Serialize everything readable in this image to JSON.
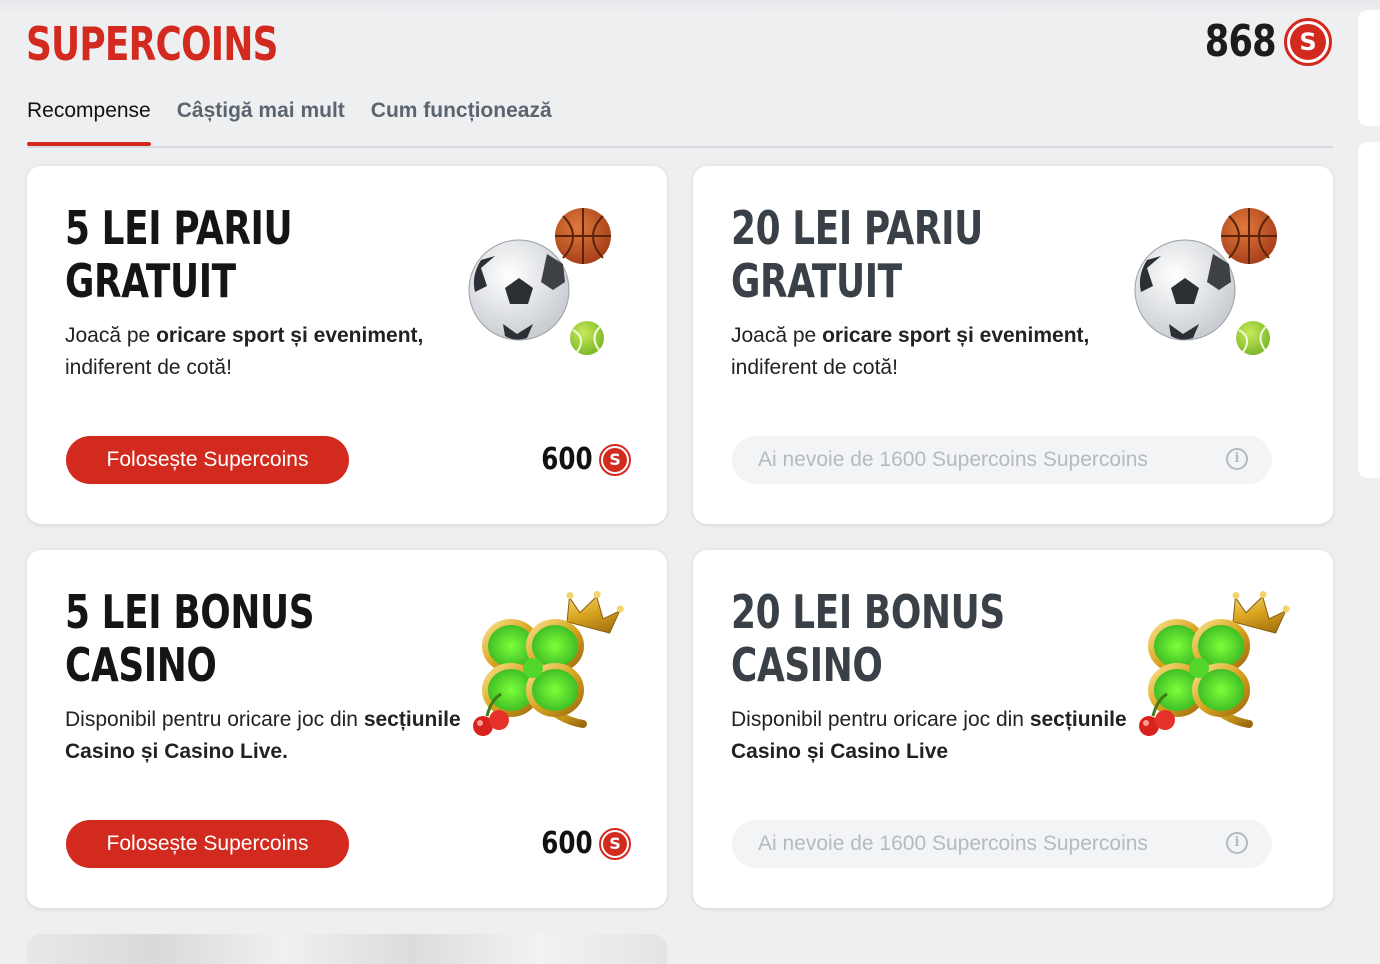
{
  "header": {
    "title": "SUPERCOINS",
    "balance": "868",
    "coin_symbol": "S"
  },
  "tabs": [
    {
      "label": "Recompense",
      "active": true
    },
    {
      "label": "Câștigă mai mult",
      "active": false
    },
    {
      "label": "Cum funcționează",
      "active": false
    }
  ],
  "cards": [
    {
      "title_line1": "5 LEI PARIU",
      "title_line2": "GRATUIT",
      "desc_pre": "Joacă pe ",
      "desc_bold": "oricare sport și eveniment,",
      "desc_post": " indiferent de cotă!",
      "button": "Folosește Supercoins",
      "cost": "600",
      "art": "sports-balls-icon"
    },
    {
      "title_line1": "20 LEI PARIU",
      "title_line2": "GRATUIT",
      "desc_pre": "Joacă pe ",
      "desc_bold": "oricare sport și eveniment,",
      "desc_post": " indiferent de cotă!",
      "locked_text": "Ai nevoie de 1600 Supercoins Supercoins",
      "art": "sports-balls-icon"
    },
    {
      "title_line1": "5 LEI BONUS",
      "title_line2": "CASINO",
      "desc_pre": "Disponibil pentru oricare joc din ",
      "desc_bold": "secțiunile Casino și Casino Live.",
      "desc_post": "",
      "button": "Folosește Supercoins",
      "cost": "600",
      "art": "clover-crown-icon"
    },
    {
      "title_line1": "20 LEI BONUS",
      "title_line2": "CASINO",
      "desc_pre": "Disponibil pentru oricare joc din ",
      "desc_bold": "secțiunile Casino și Casino Live",
      "desc_post": "",
      "locked_text": "Ai nevoie de 1600 Supercoins Supercoins",
      "art": "clover-crown-icon"
    }
  ],
  "colors": {
    "brand_red": "#d32a1f",
    "page_bg": "#eeeff1"
  }
}
